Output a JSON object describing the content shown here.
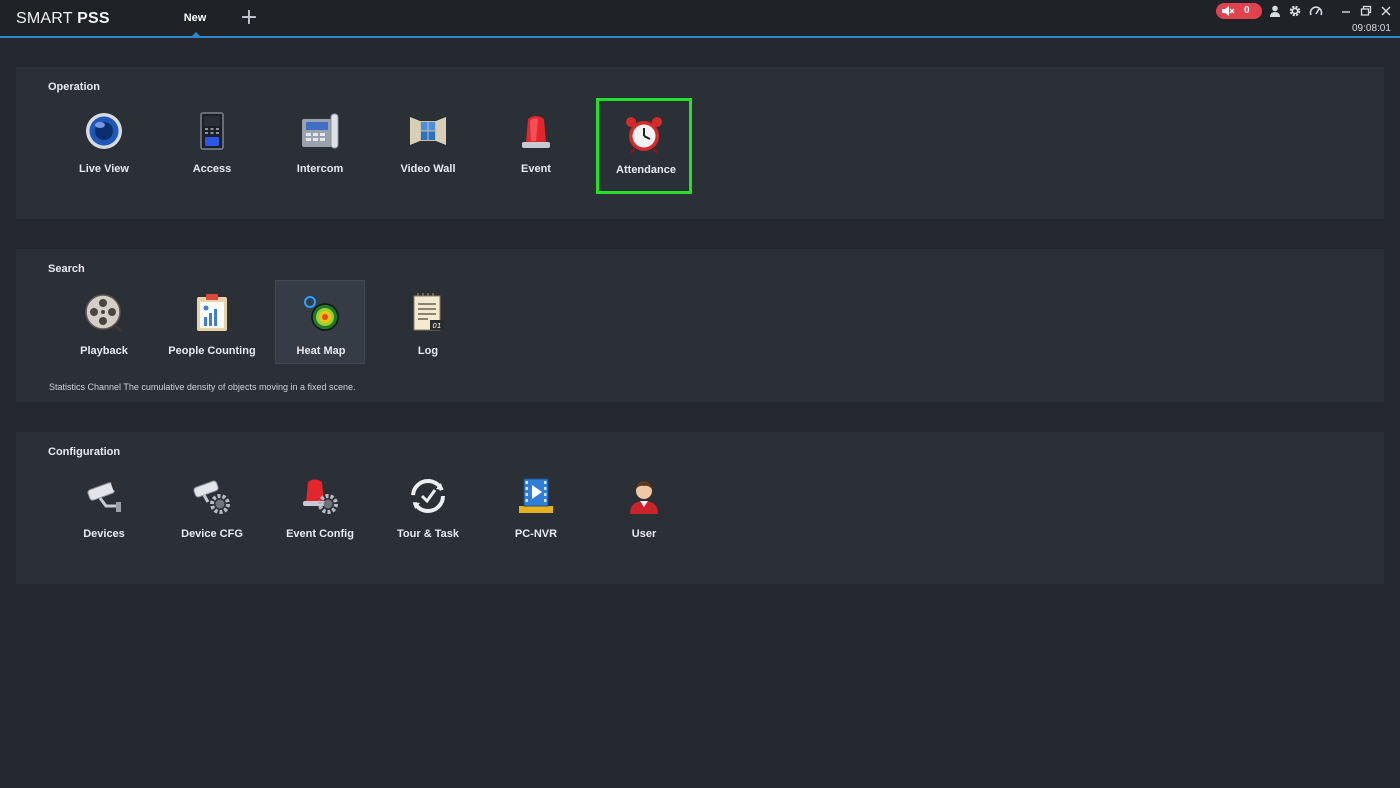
{
  "app": {
    "brand_light": "SMART ",
    "brand_bold": "PSS",
    "tab_label": "New",
    "add_tab_symbol": "+",
    "alarm_count": "0",
    "time": "09:08:01",
    "accent_color": "#2f86c8"
  },
  "operation": {
    "title": "Operation",
    "items": [
      {
        "label": "Live View",
        "icon": "live-view-icon"
      },
      {
        "label": "Access",
        "icon": "access-icon"
      },
      {
        "label": "Intercom",
        "icon": "intercom-icon"
      },
      {
        "label": "Video Wall",
        "icon": "video-wall-icon"
      },
      {
        "label": "Event",
        "icon": "event-icon"
      },
      {
        "label": "Attendance",
        "icon": "alarm-clock-icon"
      }
    ]
  },
  "search": {
    "title": "Search",
    "items": [
      {
        "label": "Playback",
        "icon": "film-reel-icon"
      },
      {
        "label": "People Counting",
        "icon": "people-counting-icon"
      },
      {
        "label": "Heat Map",
        "icon": "heat-map-icon"
      },
      {
        "label": "Log",
        "icon": "log-icon"
      }
    ],
    "description": "Statistics Channel The cumulative density of objects moving in a fixed scene."
  },
  "configuration": {
    "title": "Configuration",
    "items": [
      {
        "label": "Devices",
        "icon": "camera-icon"
      },
      {
        "label": "Device CFG",
        "icon": "camera-gear-icon"
      },
      {
        "label": "Event Config",
        "icon": "event-gear-icon"
      },
      {
        "label": "Tour & Task",
        "icon": "tour-task-icon"
      },
      {
        "label": "PC-NVR",
        "icon": "pc-nvr-icon"
      },
      {
        "label": "User",
        "icon": "user-icon"
      }
    ]
  }
}
